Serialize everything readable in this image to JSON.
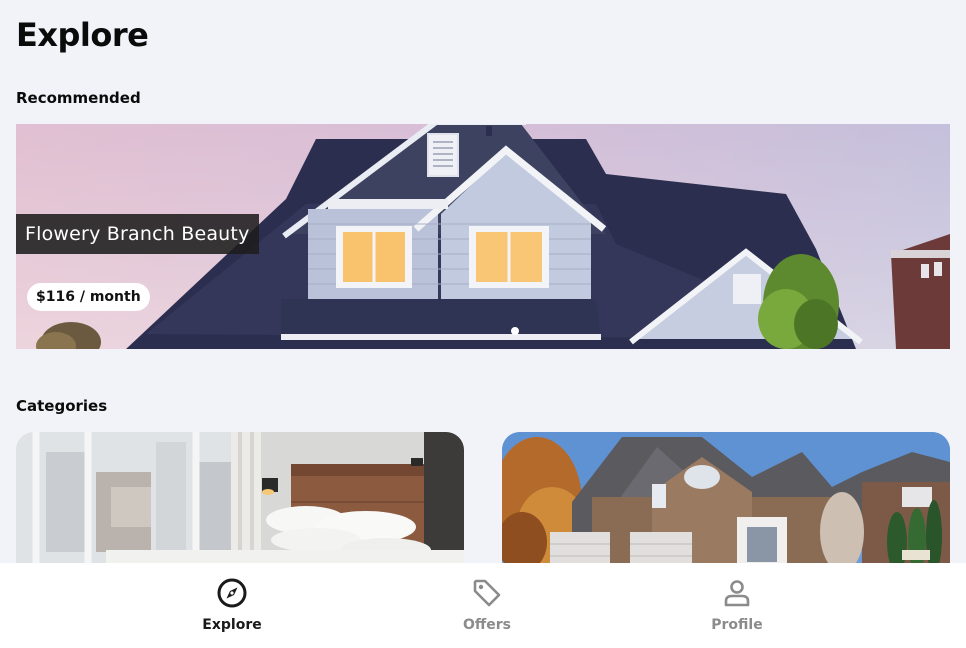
{
  "page": {
    "title": "Explore"
  },
  "recommended": {
    "section_label": "Recommended",
    "listing": {
      "name": "Flowery Branch Beauty",
      "price": "$116 / month"
    },
    "carousel": {
      "slide_count": 1,
      "active_index": 0
    }
  },
  "categories": {
    "section_label": "Categories",
    "cards": [
      {
        "image": "bedroom-photo"
      },
      {
        "image": "house-photo"
      }
    ]
  },
  "bottom_nav": {
    "items": [
      {
        "label": "Explore",
        "icon": "compass-icon",
        "active": true
      },
      {
        "label": "Offers",
        "icon": "tag-icon",
        "active": false
      },
      {
        "label": "Profile",
        "icon": "person-icon",
        "active": false
      }
    ]
  },
  "colors": {
    "background": "#f2f3f8",
    "nav_active": "#1a1a1a",
    "nav_inactive": "#8b8b8b",
    "title_overlay": "#1e1e1e"
  }
}
